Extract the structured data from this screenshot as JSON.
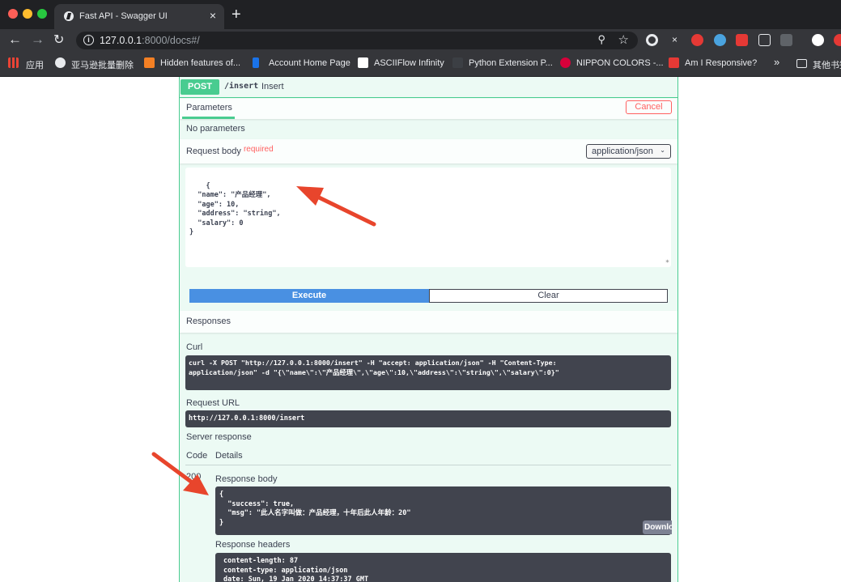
{
  "browser": {
    "tab_title": "Fast API - Swagger UI",
    "tab_close": "×",
    "new_tab": "+",
    "url_host": "127.0.0.1",
    "url_rest": ":8000/docs#/",
    "info": "i",
    "bookmarks": [
      {
        "label": "应用",
        "icon_color": "#e8eaed"
      },
      {
        "label": "亚马逊批量删除",
        "icon_color": "#e8eaed"
      },
      {
        "label": "Hidden features of...",
        "icon_color": "#f48024"
      },
      {
        "label": "Account Home Page",
        "icon_color": "#1a73e8"
      },
      {
        "label": "ASCIIFlow Infinity",
        "icon_color": "#ffffff"
      },
      {
        "label": "Python Extension P...",
        "icon_color": "#35363a"
      },
      {
        "label": "NIPPON COLORS -...",
        "icon_color": "#d7003a"
      },
      {
        "label": "Am I Responsive?",
        "icon_color": "#e53935"
      }
    ],
    "bookmarks_overflow": "»",
    "other_bookmarks": "其他书签"
  },
  "operation": {
    "method": "POST",
    "path": "/insert",
    "summary": "Insert"
  },
  "parameters": {
    "tab_label": "Parameters",
    "cancel_label": "Cancel",
    "none_text": "No parameters"
  },
  "request_body": {
    "label": "Request body",
    "required": "required",
    "content_type": "application/json",
    "json": "{\n  \"name\": \"产品经理\",\n  \"age\": 10,\n  \"address\": \"string\",\n  \"salary\": 0\n}"
  },
  "actions": {
    "execute": "Execute",
    "clear": "Clear"
  },
  "responses": {
    "title": "Responses",
    "curl_label": "Curl",
    "curl": "curl -X POST \"http://127.0.0.1:8000/insert\" -H \"accept: application/json\" -H \"Content-Type:\napplication/json\" -d \"{\\\"name\\\":\\\"产品经理\\\",\\\"age\\\":10,\\\"address\\\":\\\"string\\\",\\\"salary\\\":0}\"",
    "request_url_label": "Request URL",
    "request_url": "http://127.0.0.1:8000/insert",
    "server_response_label": "Server response",
    "code_header": "Code",
    "details_header": "Details",
    "code": "200",
    "response_body_label": "Response body",
    "response_body": "{\n  \"success\": true,\n  \"msg\": \"此人名字叫做：产品经理，十年后此人年龄：20\"\n}",
    "download_label": "Download",
    "response_headers_label": "Response headers",
    "response_headers": "content-length: 87\ncontent-type: application/json\ndate: Sun, 19 Jan 2020 14:37:37 GMT"
  },
  "colors": {
    "post_green": "#49cc90",
    "execute_blue": "#4990e2",
    "cancel_red": "#ff6060",
    "code_bg": "#41444e",
    "arrow": "#e8452c"
  }
}
